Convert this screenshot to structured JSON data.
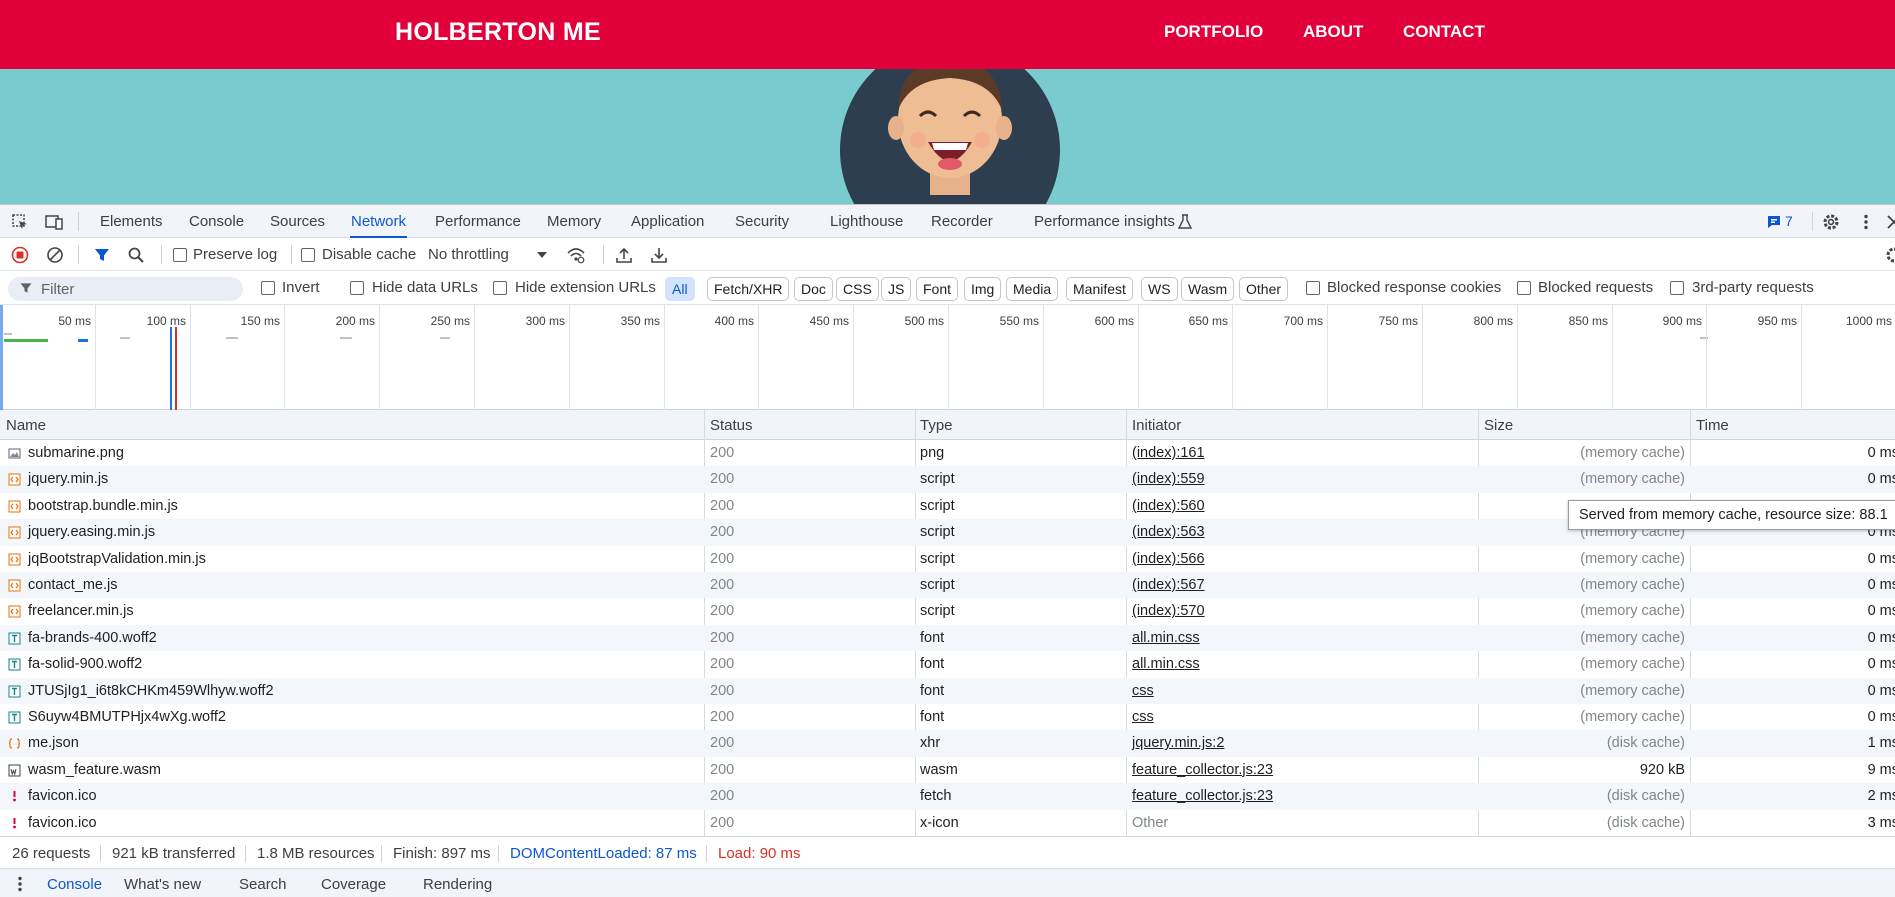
{
  "site": {
    "brand": "HOLBERTON ME",
    "nav": [
      "PORTFOLIO",
      "ABOUT",
      "CONTACT"
    ],
    "colors": {
      "nav_bg": "#e2003b",
      "hero_bg": "#7acbd0"
    }
  },
  "devtools": {
    "tabs": [
      "Elements",
      "Console",
      "Sources",
      "Network",
      "Performance",
      "Memory",
      "Application",
      "Security",
      "Lighthouse",
      "Recorder",
      "Performance insights"
    ],
    "active_tab": "Network",
    "issues_count": "7",
    "toolbar": {
      "preserve_log": "Preserve log",
      "disable_cache": "Disable cache",
      "throttling": "No throttling"
    },
    "filterbar": {
      "filter_placeholder": "Filter",
      "invert": "Invert",
      "hide_data_urls": "Hide data URLs",
      "hide_extension_urls": "Hide extension URLs",
      "type_filters": [
        "All",
        "Fetch/XHR",
        "Doc",
        "CSS",
        "JS",
        "Font",
        "Img",
        "Media",
        "Manifest",
        "WS",
        "Wasm",
        "Other"
      ],
      "active_type": "All",
      "blocked_response_cookies": "Blocked response cookies",
      "blocked_requests": "Blocked requests",
      "third_party_requests": "3rd-party requests"
    },
    "overview_ticks": [
      "50 ms",
      "100 ms",
      "150 ms",
      "200 ms",
      "250 ms",
      "300 ms",
      "350 ms",
      "400 ms",
      "450 ms",
      "500 ms",
      "550 ms",
      "600 ms",
      "650 ms",
      "700 ms",
      "750 ms",
      "800 ms",
      "850 ms",
      "900 ms",
      "950 ms",
      "1000 ms"
    ],
    "table": {
      "headers": {
        "name": "Name",
        "status": "Status",
        "type": "Type",
        "initiator": "Initiator",
        "size": "Size",
        "time": "Time"
      },
      "rows": [
        {
          "name": "submarine.png",
          "status": "200",
          "type": "png",
          "initiator": "(index):161",
          "size": "(memory cache)",
          "time": "0 ms",
          "icon": "image-file-icon"
        },
        {
          "name": "jquery.min.js",
          "status": "200",
          "type": "script",
          "initiator": "(index):559",
          "size": "(memory cache)",
          "time": "0 ms",
          "icon": "script-file-icon"
        },
        {
          "name": "bootstrap.bundle.min.js",
          "status": "200",
          "type": "script",
          "initiator": "(index):560",
          "size": "",
          "time": "",
          "icon": "script-file-icon"
        },
        {
          "name": "jquery.easing.min.js",
          "status": "200",
          "type": "script",
          "initiator": "(index):563",
          "size": "(memory cache)",
          "time": "0 ms",
          "icon": "script-file-icon"
        },
        {
          "name": "jqBootstrapValidation.min.js",
          "status": "200",
          "type": "script",
          "initiator": "(index):566",
          "size": "(memory cache)",
          "time": "0 ms",
          "icon": "script-file-icon"
        },
        {
          "name": "contact_me.js",
          "status": "200",
          "type": "script",
          "initiator": "(index):567",
          "size": "(memory cache)",
          "time": "0 ms",
          "icon": "script-file-icon"
        },
        {
          "name": "freelancer.min.js",
          "status": "200",
          "type": "script",
          "initiator": "(index):570",
          "size": "(memory cache)",
          "time": "0 ms",
          "icon": "script-file-icon"
        },
        {
          "name": "fa-brands-400.woff2",
          "status": "200",
          "type": "font",
          "initiator": "all.min.css",
          "size": "(memory cache)",
          "time": "0 ms",
          "icon": "font-file-icon"
        },
        {
          "name": "fa-solid-900.woff2",
          "status": "200",
          "type": "font",
          "initiator": "all.min.css",
          "size": "(memory cache)",
          "time": "0 ms",
          "icon": "font-file-icon"
        },
        {
          "name": "JTUSjIg1_i6t8kCHKm459Wlhyw.woff2",
          "status": "200",
          "type": "font",
          "initiator": "css",
          "size": "(memory cache)",
          "time": "0 ms",
          "icon": "font-file-icon"
        },
        {
          "name": "S6uyw4BMUTPHjx4wXg.woff2",
          "status": "200",
          "type": "font",
          "initiator": "css",
          "size": "(memory cache)",
          "time": "0 ms",
          "icon": "font-file-icon"
        },
        {
          "name": "me.json",
          "status": "200",
          "type": "xhr",
          "initiator": "jquery.min.js:2",
          "size": "(disk cache)",
          "time": "1 ms",
          "icon": "json-file-icon"
        },
        {
          "name": "wasm_feature.wasm",
          "status": "200",
          "type": "wasm",
          "initiator": "feature_collector.js:23",
          "size": "920 kB",
          "time": "9 ms",
          "icon": "wasm-file-icon"
        },
        {
          "name": "favicon.ico",
          "status": "200",
          "type": "fetch",
          "initiator": "feature_collector.js:23",
          "size": "(disk cache)",
          "time": "2 ms",
          "icon": "favicon-file-icon"
        },
        {
          "name": "favicon.ico",
          "status": "200",
          "type": "x-icon",
          "initiator": "Other",
          "size": "(disk cache)",
          "time": "3 ms",
          "icon": "favicon-file-icon"
        }
      ]
    },
    "tooltip": "Served from memory cache, resource size: 88.1",
    "summary": {
      "requests": "26 requests",
      "transferred": "921 kB transferred",
      "resources": "1.8 MB resources",
      "finish": "Finish: 897 ms",
      "dom_content_loaded": "DOMContentLoaded: 87 ms",
      "load": "Load: 90 ms"
    },
    "drawer_tabs": [
      "Console",
      "What's new",
      "Search",
      "Coverage",
      "Rendering"
    ],
    "active_drawer_tab": "Console"
  }
}
